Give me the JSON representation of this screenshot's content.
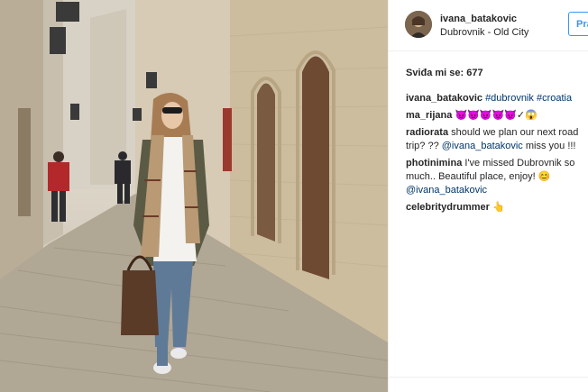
{
  "post": {
    "username": "ivana_batakovic",
    "location": "Dubrovnik - Old City",
    "follow_label": "Pra",
    "likes_label": "Sviđa mi se: 677"
  },
  "comments": [
    {
      "user": "ivana_batakovic",
      "text": "",
      "tags": [
        "#dubrovnik",
        "#croatia"
      ]
    },
    {
      "user": "ma_rijana",
      "text": "😈😈😈😈😈✓😱"
    },
    {
      "user": "radiorata",
      "text": "should we plan our next road trip? ?? ",
      "mention": "@ivana_batakovic",
      "tail": " miss you !!!"
    },
    {
      "user": "photinimina",
      "text": "I've missed Dubrovnik so much.. Beautiful place, enjoy! 😊 ",
      "mention": "@ivana_batakovic",
      "tail": ""
    },
    {
      "user": "celebritydrummer",
      "text": "👆"
    }
  ],
  "colors": {
    "link": "#003569",
    "follow": "#3897f0",
    "divider": "#efefef"
  }
}
